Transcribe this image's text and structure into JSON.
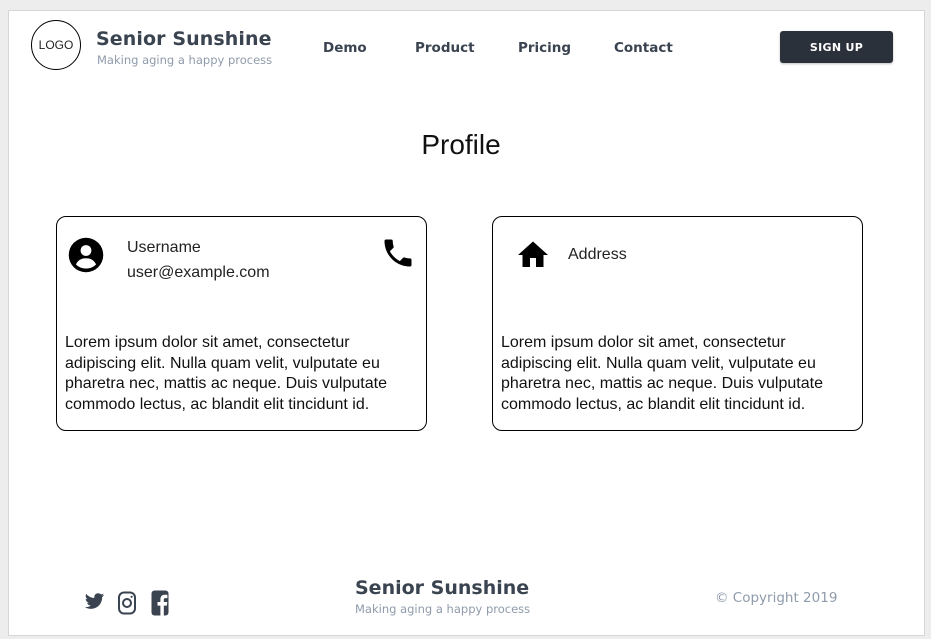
{
  "header": {
    "logo_text": "LOGO",
    "brand_title": "Senior Sunshine",
    "brand_tagline": "Making aging a happy process",
    "nav": [
      {
        "label": "Demo"
      },
      {
        "label": "Product"
      },
      {
        "label": "Pricing"
      },
      {
        "label": "Contact"
      }
    ],
    "signup_label": "SIGN UP"
  },
  "main": {
    "page_title": "Profile",
    "user_card": {
      "username_label": "Username",
      "email": "user@example.com",
      "icons": [
        "account-circle-icon",
        "phone-icon"
      ],
      "body": "Lorem ipsum dolor sit amet, consectetur adipiscing elit. Nulla quam velit, vulputate eu pharetra nec, mattis ac neque. Duis vulputate commodo lectus, ac blandit elit tincidunt id."
    },
    "address_card": {
      "address_label": "Address",
      "icons": [
        "home-icon"
      ],
      "body": "Lorem ipsum dolor sit amet, consectetur adipiscing elit. Nulla quam velit, vulputate eu pharetra nec, mattis ac neque. Duis vulputate commodo lectus, ac blandit elit tincidunt id."
    }
  },
  "footer": {
    "social_icons": [
      "twitter-icon",
      "instagram-icon",
      "facebook-icon"
    ],
    "brand_title": "Senior Sunshine",
    "brand_tagline": "Making aging a happy process",
    "copyright": "© Copyright 2019"
  },
  "colors": {
    "text_dark": "#3a4350",
    "text_muted": "#8f9bab",
    "button_bg": "#2b313b",
    "button_text": "#ffffff"
  }
}
